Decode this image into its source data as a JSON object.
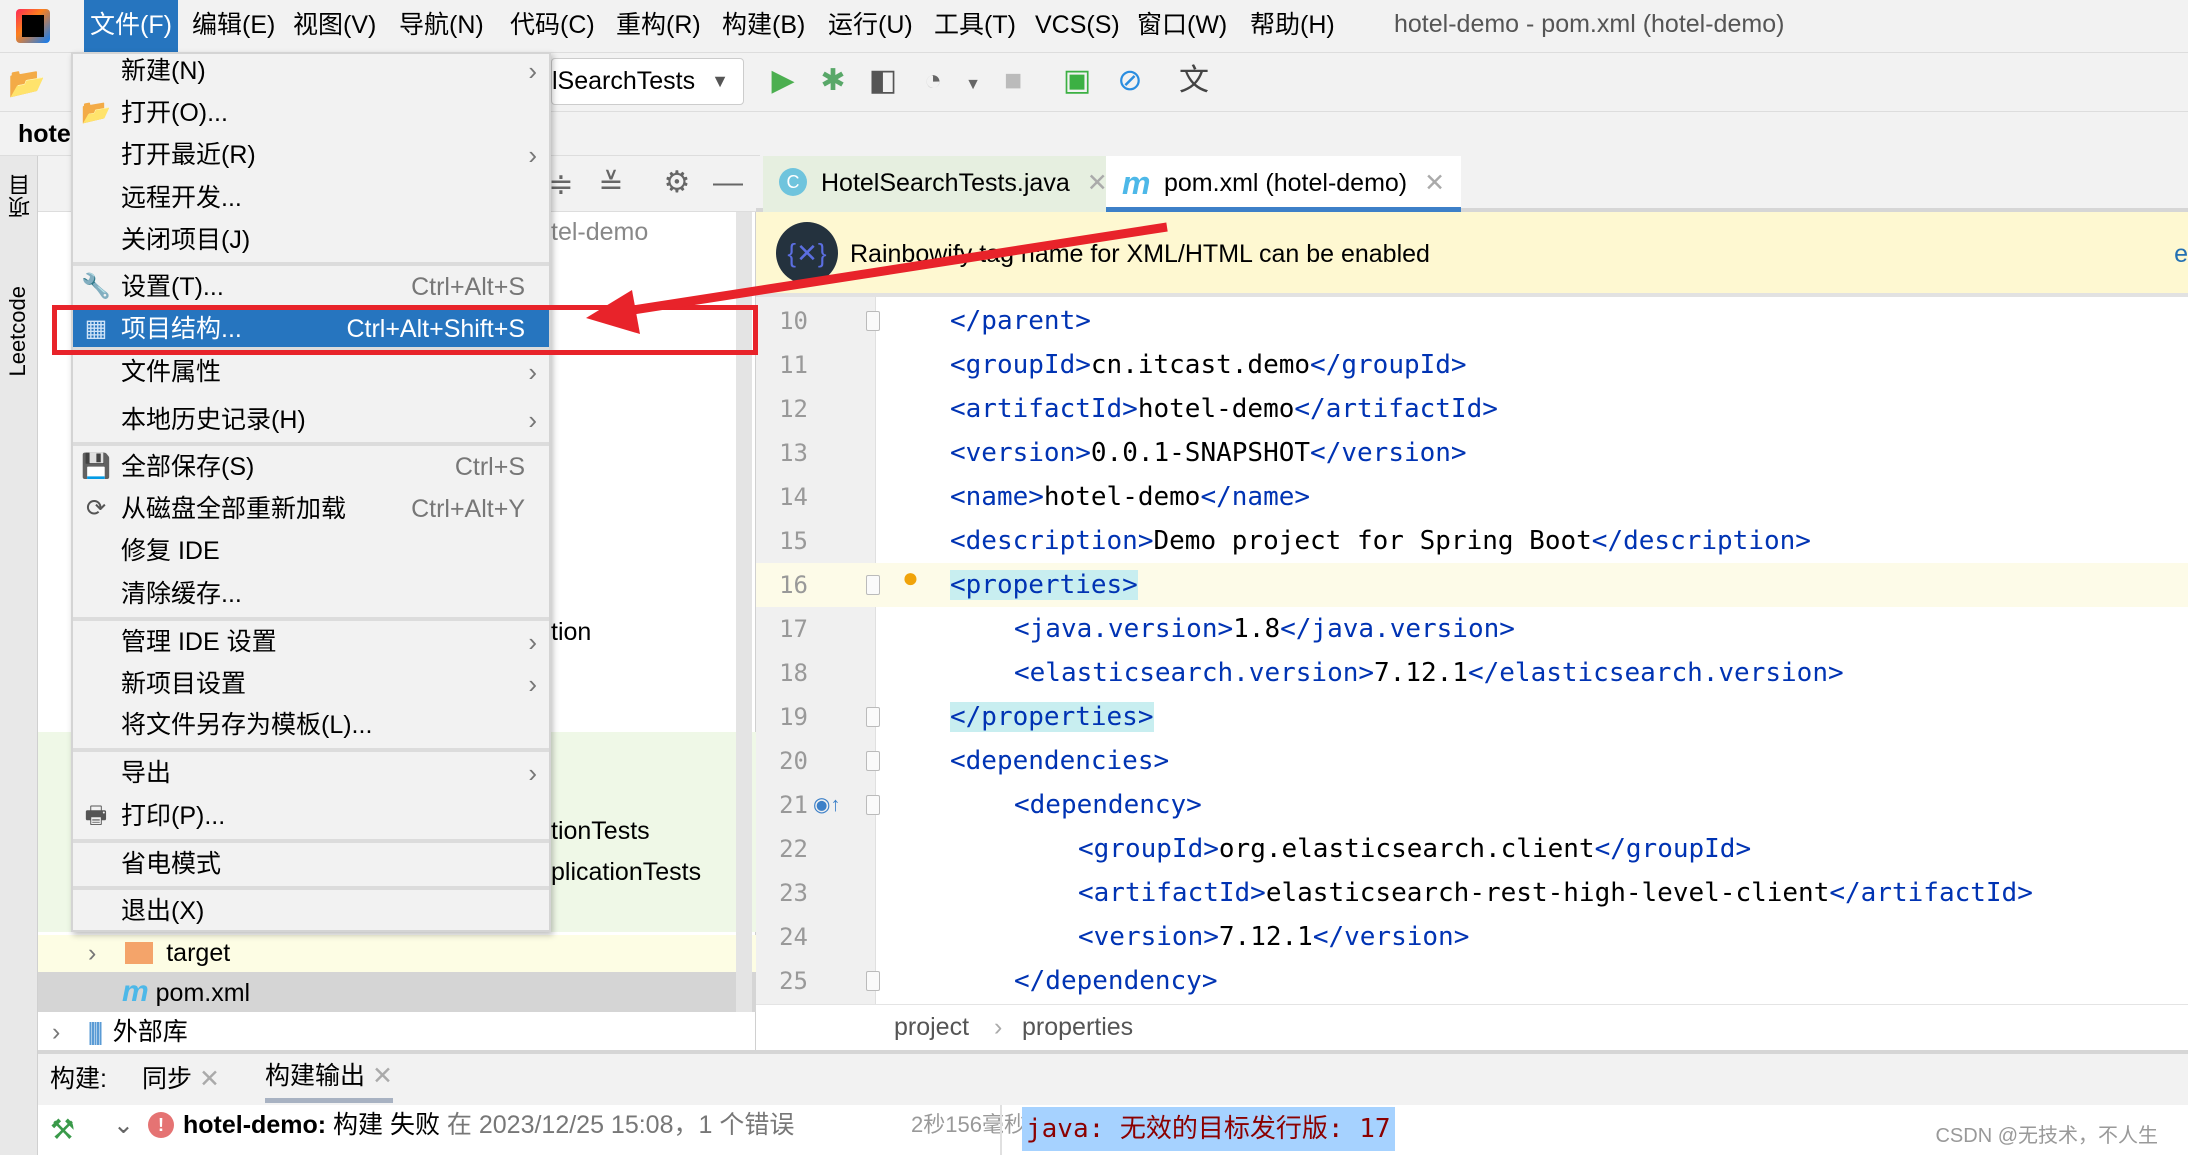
{
  "window": {
    "title": "hotel-demo - pom.xml (hotel-demo)"
  },
  "menubar": {
    "items": [
      "文件(F)",
      "编辑(E)",
      "视图(V)",
      "导航(N)",
      "代码(C)",
      "重构(R)",
      "构建(B)",
      "运行(U)",
      "工具(T)",
      "VCS(S)",
      "窗口(W)",
      "帮助(H)"
    ],
    "active": "文件(F)"
  },
  "toolbar": {
    "run_config": "lSearchTests",
    "icons": [
      "run-icon",
      "debug-icon",
      "coverage-icon",
      "profile-icon",
      "stop-icon",
      "monitor-icon",
      "disable-icon",
      "translate-icon"
    ]
  },
  "navbar": {
    "project": "hote"
  },
  "left_strip": {
    "project_label": "项目",
    "leetcode_label": "Leetcode"
  },
  "file_menu": {
    "items": [
      {
        "label": "新建(N)",
        "submenu": true
      },
      {
        "label": "打开(O)...",
        "icon": "folder-open-icon"
      },
      {
        "label": "打开最近(R)",
        "submenu": true
      },
      {
        "label": "远程开发..."
      },
      {
        "label": "关闭项目(J)"
      },
      {
        "label": "设置(T)...",
        "shortcut": "Ctrl+Alt+S",
        "icon": "wrench-icon"
      },
      {
        "label": "项目结构...",
        "shortcut": "Ctrl+Alt+Shift+S",
        "icon": "project-structure-icon",
        "selected": true
      },
      {
        "label": "文件属性",
        "submenu": true
      },
      {
        "label": "本地历史记录(H)",
        "submenu": true
      },
      {
        "label": "全部保存(S)",
        "shortcut": "Ctrl+S",
        "icon": "save-icon"
      },
      {
        "label": "从磁盘全部重新加载",
        "shortcut": "Ctrl+Alt+Y",
        "icon": "reload-icon"
      },
      {
        "label": "修复 IDE"
      },
      {
        "label": "清除缓存..."
      },
      {
        "label": "管理 IDE 设置",
        "submenu": true
      },
      {
        "label": "新项目设置",
        "submenu": true
      },
      {
        "label": "将文件另存为模板(L)..."
      },
      {
        "label": "导出",
        "submenu": true
      },
      {
        "label": "打印(P)...",
        "icon": "print-icon"
      },
      {
        "label": "省电模式"
      },
      {
        "label": "退出(X)"
      }
    ]
  },
  "project_tree": {
    "partial": [
      "tel-demo",
      "tion",
      "tionTests",
      "plicationTests"
    ],
    "items": [
      {
        "label": "target",
        "icon": "folder-icon"
      },
      {
        "label": "pom.xml",
        "icon": "maven-icon",
        "selected": true
      },
      {
        "label": "外部库",
        "icon": "library-icon"
      }
    ]
  },
  "editor": {
    "tabs": [
      {
        "label": "HotelSearchTests.java",
        "icon": "java-class-icon"
      },
      {
        "label": "pom.xml (hotel-demo)",
        "icon": "maven-icon",
        "active": true
      }
    ],
    "banner": {
      "text": "Rainbowify tag name for XML/HTML can be enabled",
      "action": "e"
    },
    "lines": [
      {
        "num": "10",
        "indent": 1,
        "parts": [
          [
            "</parent>",
            "tag"
          ]
        ]
      },
      {
        "num": "11",
        "indent": 1,
        "parts": [
          [
            "<groupId>",
            "tag"
          ],
          [
            "cn.itcast.demo",
            ""
          ],
          [
            "</groupId>",
            "tag"
          ]
        ]
      },
      {
        "num": "12",
        "indent": 1,
        "parts": [
          [
            "<artifactId>",
            "tag"
          ],
          [
            "hotel-demo",
            ""
          ],
          [
            "</artifactId>",
            "tag"
          ]
        ]
      },
      {
        "num": "13",
        "indent": 1,
        "parts": [
          [
            "<version>",
            "tag"
          ],
          [
            "0.0.1-SNAPSHOT",
            ""
          ],
          [
            "</version>",
            "tag"
          ]
        ]
      },
      {
        "num": "14",
        "indent": 1,
        "parts": [
          [
            "<name>",
            "tag"
          ],
          [
            "hotel-demo",
            ""
          ],
          [
            "</name>",
            "tag"
          ]
        ]
      },
      {
        "num": "15",
        "indent": 1,
        "parts": [
          [
            "<description>",
            "tag"
          ],
          [
            "Demo project for Spring Boot",
            ""
          ],
          [
            "</description>",
            "tag"
          ]
        ]
      },
      {
        "num": "16",
        "indent": 1,
        "caret": true,
        "parts": [
          [
            "<properties>",
            "tag hl"
          ]
        ]
      },
      {
        "num": "17",
        "indent": 2,
        "parts": [
          [
            "<java.version>",
            "tag"
          ],
          [
            "1.8",
            ""
          ],
          [
            "</java.version>",
            "tag"
          ]
        ]
      },
      {
        "num": "18",
        "indent": 2,
        "parts": [
          [
            "<elasticsearch.version>",
            "tag"
          ],
          [
            "7.12.1",
            ""
          ],
          [
            "</elasticsearch.version>",
            "tag"
          ]
        ]
      },
      {
        "num": "19",
        "indent": 1,
        "parts": [
          [
            "</properties>",
            "tag hl"
          ]
        ]
      },
      {
        "num": "20",
        "indent": 1,
        "parts": [
          [
            "<dependencies>",
            "tag"
          ]
        ]
      },
      {
        "num": "21",
        "indent": 2,
        "parts": [
          [
            "<dependency>",
            "tag"
          ]
        ]
      },
      {
        "num": "22",
        "indent": 3,
        "parts": [
          [
            "<groupId>",
            "tag"
          ],
          [
            "org.elasticsearch.client",
            ""
          ],
          [
            "</groupId>",
            "tag"
          ]
        ]
      },
      {
        "num": "23",
        "indent": 3,
        "parts": [
          [
            "<artifactId>",
            "tag"
          ],
          [
            "elasticsearch-rest-high-level-client",
            ""
          ],
          [
            "</artifactId>",
            "tag"
          ]
        ]
      },
      {
        "num": "24",
        "indent": 3,
        "parts": [
          [
            "<version>",
            "tag"
          ],
          [
            "7.12.1",
            ""
          ],
          [
            "</version>",
            "tag"
          ]
        ]
      },
      {
        "num": "25",
        "indent": 2,
        "parts": [
          [
            "</dependency>",
            "tag"
          ]
        ]
      }
    ],
    "breadcrumb": [
      "project",
      "properties"
    ]
  },
  "build": {
    "label": "构建:",
    "tabs": [
      {
        "label": "同步"
      },
      {
        "label": "构建输出",
        "active": true
      }
    ],
    "result": {
      "project": "hotel-demo:",
      "status": "构建 失败",
      "detail": "在 2023/12/25 15:08，1 个错误",
      "duration": "2秒156毫秒"
    },
    "error_output": "java: 无效的目标发行版: 17"
  },
  "watermark": "CSDN @无技术，不人生",
  "colors": {
    "accent": "#2675bf",
    "tag": "#0033b3",
    "error": "#e05555",
    "annotation": "#e8232a"
  }
}
